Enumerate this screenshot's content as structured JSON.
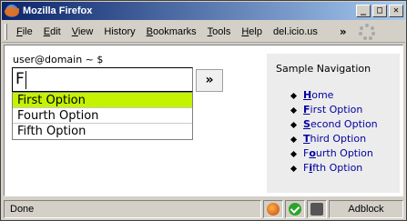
{
  "window": {
    "title": "Mozilla Firefox"
  },
  "menubar": {
    "items": [
      {
        "label": "File",
        "key": "F",
        "rest": "ile"
      },
      {
        "label": "Edit",
        "key": "E",
        "rest": "dit"
      },
      {
        "label": "View",
        "key": "V",
        "rest": "iew"
      },
      {
        "label": "History",
        "key": "H",
        "rest": "istory"
      },
      {
        "label": "Bookmarks",
        "key": "B",
        "rest": "ookmarks"
      },
      {
        "label": "Tools",
        "key": "T",
        "rest": "ools"
      },
      {
        "label": "Help",
        "key": "H",
        "rest": "elp"
      },
      {
        "label": "del.icio.us",
        "key": "",
        "rest": "del.icio.us"
      }
    ],
    "overflow": "»"
  },
  "page": {
    "prompt": "user@domain ~ $",
    "input_value": "F",
    "go_label": "»",
    "suggestions": [
      "First Option",
      "Fourth Option",
      "Fifth Option"
    ],
    "highlight_color": "#c4f200",
    "nav": {
      "title": "Sample Navigation",
      "items": [
        {
          "key": "H",
          "rest": "ome"
        },
        {
          "key": "F",
          "rest": "irst Option"
        },
        {
          "key": "S",
          "rest": "econd Option"
        },
        {
          "key": "T",
          "rest": "hird Option"
        },
        {
          "pre": "F",
          "key": "o",
          "rest": "urth Option"
        },
        {
          "pre": "F",
          "key": "i",
          "rest": "fth Option"
        }
      ]
    }
  },
  "status": {
    "text": "Done",
    "icons": [
      "firefox-icon",
      "check-icon",
      "tool-icon"
    ],
    "adblock": "Adblock"
  }
}
